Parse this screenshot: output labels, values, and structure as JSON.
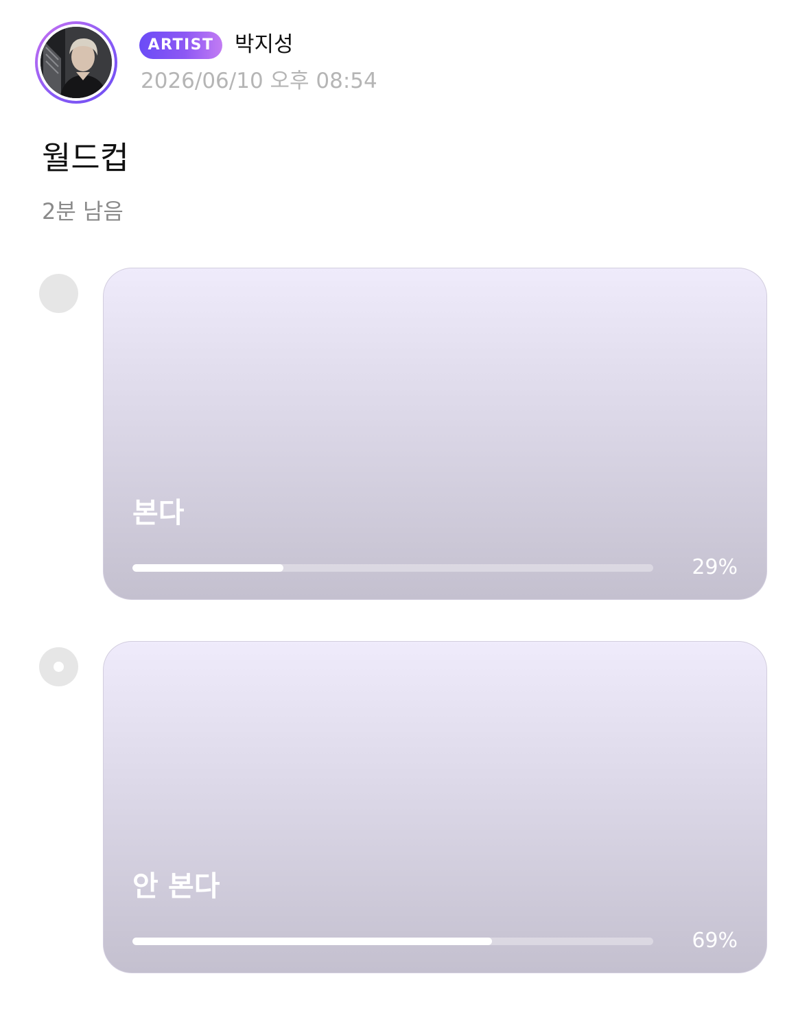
{
  "post": {
    "badge": "ARTIST",
    "author": "박지성",
    "timestamp": "2026/06/10 오후 08:54",
    "title": "월드컵",
    "time_left": "2분 남음"
  },
  "options": [
    {
      "label": "본다",
      "percent_text": "29%",
      "ratio": 0.29,
      "selected": false
    },
    {
      "label": "안 본다",
      "percent_text": "69%",
      "ratio": 0.69,
      "selected": true
    }
  ],
  "colors": {
    "badge_gradient_start": "#6b4cf6",
    "badge_gradient_end": "#c27cf3",
    "card_top": "#efebfb",
    "card_bottom": "#c4c0cf",
    "radio": "#e6e6e6"
  },
  "icons": {
    "avatar": "profile-photo",
    "radio_unselected": "radio-empty-icon",
    "radio_selected": "radio-selected-icon"
  }
}
